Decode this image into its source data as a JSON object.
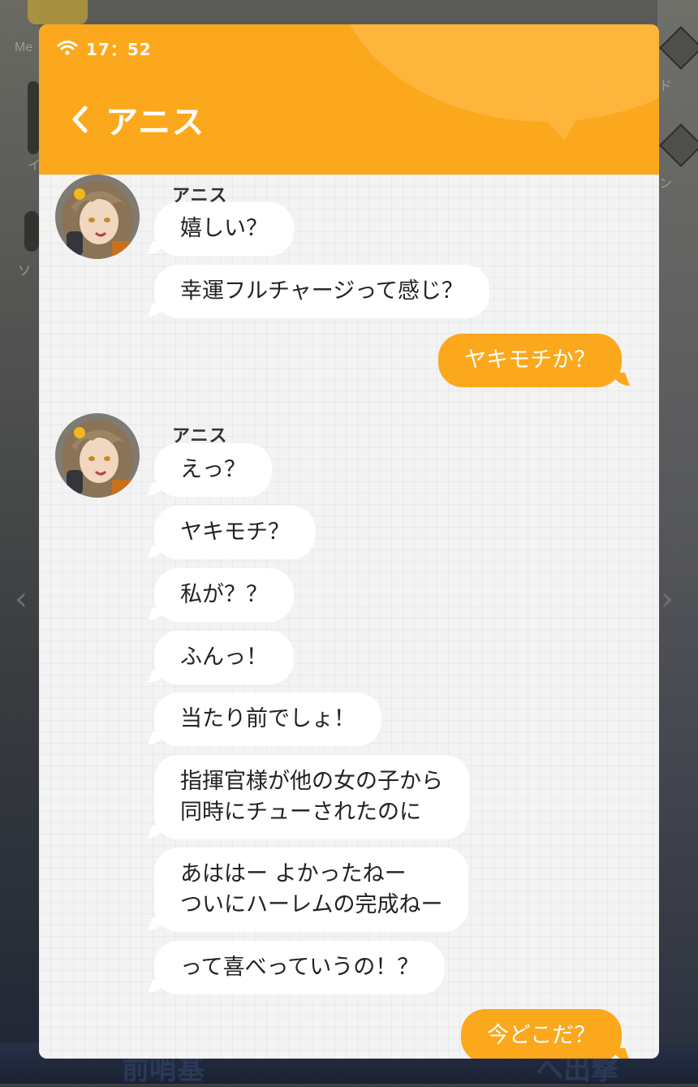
{
  "status": {
    "time": "17：52"
  },
  "chat": {
    "title": "アニス"
  },
  "background": {
    "left_label_1": "Me",
    "left_label_2": "イ",
    "left_label_3": "ソ",
    "right_label_1": "ド",
    "right_label_2": "ン",
    "bottom_left": "前哨基",
    "bottom_right": "へ出撃"
  },
  "messages": [
    {
      "sender": "アニス",
      "bubbles": [
        "嬉しい？",
        "幸運フルチャージって感じ？"
      ]
    },
    {
      "outgoing": "ヤキモチか？"
    },
    {
      "sender": "アニス",
      "bubbles": [
        "えっ？",
        "ヤキモチ？",
        "私が？？",
        "ふんっ！",
        "当たり前でしょ！",
        "指揮官様が他の女の子から\n同時にチューされたのに",
        "あははー よかったねー\nついにハーレムの完成ねー",
        "って喜べっていうの！？"
      ]
    },
    {
      "outgoing": "今どこだ？"
    }
  ],
  "colors": {
    "accent": "#fca81c",
    "bubble_in": "#ffffff",
    "chat_bg": "#f3f3f4"
  }
}
